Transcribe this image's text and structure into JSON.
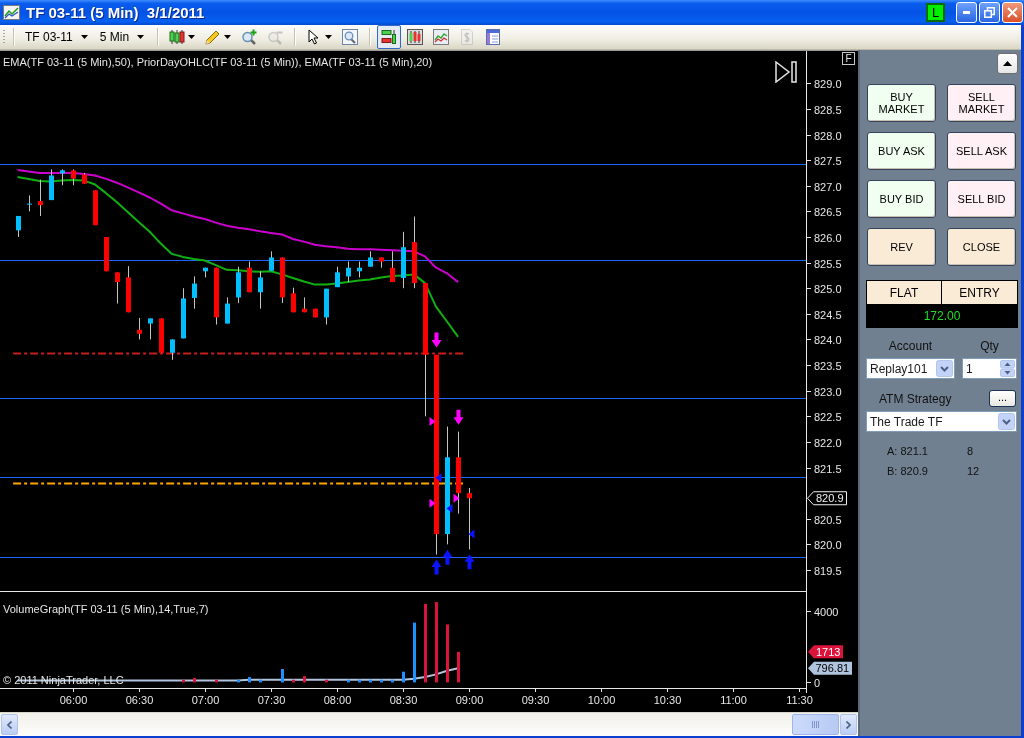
{
  "window": {
    "title": "TF 03-11 (5 Min)  3/1/2011",
    "connection_badge": "L"
  },
  "toolbar": {
    "instrument": "TF 03-11",
    "interval": "5 Min",
    "tool_groups": [
      [
        {
          "kind": "bar-style",
          "dropdown": true,
          "selected": false,
          "disabled": false
        },
        {
          "kind": "pencil",
          "dropdown": true,
          "selected": false,
          "disabled": false
        },
        {
          "kind": "zoom-in",
          "dropdown": false,
          "selected": false,
          "disabled": false
        },
        {
          "kind": "zoom-out",
          "dropdown": false,
          "selected": false,
          "disabled": true
        }
      ],
      [
        {
          "kind": "pointer",
          "dropdown": true,
          "selected": false,
          "disabled": false
        },
        {
          "kind": "zoom-box",
          "dropdown": false,
          "selected": false,
          "disabled": false
        }
      ],
      [
        {
          "kind": "chart-trader",
          "dropdown": false,
          "selected": true,
          "disabled": false
        },
        {
          "kind": "data-box",
          "dropdown": false,
          "selected": false,
          "disabled": false
        },
        {
          "kind": "indicators",
          "dropdown": false,
          "selected": false,
          "disabled": false
        },
        {
          "kind": "strategies",
          "dropdown": false,
          "selected": false,
          "disabled": true
        },
        {
          "kind": "properties",
          "dropdown": false,
          "selected": false,
          "disabled": false
        }
      ]
    ]
  },
  "chart": {
    "corner_button": "F",
    "price_pane": {
      "legend": "EMA(TF 03-11 (5 Min),50), PriorDayOHLC(TF 03-11 (5 Min)), EMA(TF 03-11 (5 Min),20)",
      "last_price": "820.9"
    },
    "volume_pane": {
      "legend": "VolumeGraph(TF 03-11 (5 Min),14,True,7)",
      "copyright": "© 2011 NinjaTrader, LLC",
      "last_volume": "1713",
      "average_volume": "796.81"
    },
    "chart_data": [
      {
        "type": "candlestick",
        "tick_labels": "y",
        "xlim": [
          "2011-03-01T05:27",
          "2011-03-01T11:33"
        ],
        "ylim": [
          819.07,
          829.63
        ],
        "yticks": [
          {
            "value": 819.5,
            "label": "819.5"
          },
          {
            "value": 820,
            "label": "820.0"
          },
          {
            "value": 820.5,
            "label": "820.5"
          },
          {
            "value": 821.5,
            "label": "821.5"
          },
          {
            "value": 822,
            "label": "822.0"
          },
          {
            "value": 822.5,
            "label": "822.5"
          },
          {
            "value": 823,
            "label": "823.0"
          },
          {
            "value": 823.5,
            "label": "823.5"
          },
          {
            "value": 824,
            "label": "824.0"
          },
          {
            "value": 824.5,
            "label": "824.5"
          },
          {
            "value": 825,
            "label": "825.0"
          },
          {
            "value": 825.5,
            "label": "825.5"
          },
          {
            "value": 826,
            "label": "826.0"
          },
          {
            "value": 826.5,
            "label": "826.5"
          },
          {
            "value": 827,
            "label": "827.0"
          },
          {
            "value": 827.5,
            "label": "827.5"
          },
          {
            "value": 828,
            "label": "828.0"
          },
          {
            "value": 828.5,
            "label": "828.5"
          },
          {
            "value": 829,
            "label": "829.0"
          }
        ],
        "x": [
          "2011-03-01T05:35",
          "2011-03-01T05:40",
          "2011-03-01T05:45",
          "2011-03-01T05:50",
          "2011-03-01T05:55",
          "2011-03-01T06:00",
          "2011-03-01T06:05",
          "2011-03-01T06:10",
          "2011-03-01T06:15",
          "2011-03-01T06:20",
          "2011-03-01T06:25",
          "2011-03-01T06:30",
          "2011-03-01T06:35",
          "2011-03-01T06:40",
          "2011-03-01T06:45",
          "2011-03-01T06:50",
          "2011-03-01T06:55",
          "2011-03-01T07:00",
          "2011-03-01T07:05",
          "2011-03-01T07:10",
          "2011-03-01T07:15",
          "2011-03-01T07:20",
          "2011-03-01T07:25",
          "2011-03-01T07:30",
          "2011-03-01T07:35",
          "2011-03-01T07:40",
          "2011-03-01T07:45",
          "2011-03-01T07:50",
          "2011-03-01T07:55",
          "2011-03-01T08:00",
          "2011-03-01T08:05",
          "2011-03-01T08:10",
          "2011-03-01T08:15",
          "2011-03-01T08:20",
          "2011-03-01T08:25",
          "2011-03-01T08:30",
          "2011-03-01T08:35",
          "2011-03-01T08:40",
          "2011-03-01T08:45",
          "2011-03-01T08:50",
          "2011-03-01T08:55",
          "2011-03-01T09:00"
        ],
        "ohlc": [
          [
            826.13,
            826.41,
            826.0,
            826.41
          ],
          [
            826.65,
            826.81,
            826.5,
            826.65
          ],
          [
            826.7,
            827.12,
            826.41,
            826.62
          ],
          [
            826.72,
            827.32,
            826.72,
            827.2
          ],
          [
            827.24,
            827.32,
            827.01,
            827.3
          ],
          [
            827.3,
            827.32,
            827.01,
            827.14
          ],
          [
            827.22,
            827.25,
            827.04,
            827.04
          ],
          [
            826.91,
            826.91,
            826.23,
            826.23
          ],
          [
            826.0,
            826.0,
            825.33,
            825.33
          ],
          [
            825.31,
            825.31,
            824.7,
            825.12
          ],
          [
            825.21,
            825.43,
            824.53,
            824.53
          ],
          [
            824.19,
            824.42,
            824.0,
            824.11
          ],
          [
            824.31,
            824.41,
            824.0,
            824.41
          ],
          [
            824.41,
            824.41,
            823.74,
            823.74
          ],
          [
            823.74,
            824.0,
            823.6,
            824.0
          ],
          [
            824.02,
            825.0,
            824.02,
            824.8
          ],
          [
            824.81,
            825.23,
            824.6,
            825.09
          ],
          [
            825.33,
            825.4,
            825.21,
            825.4
          ],
          [
            825.4,
            825.4,
            824.29,
            824.43
          ],
          [
            824.31,
            824.82,
            824.31,
            824.7
          ],
          [
            824.82,
            825.42,
            824.71,
            825.31
          ],
          [
            825.4,
            825.52,
            824.92,
            824.92
          ],
          [
            824.92,
            825.33,
            824.6,
            825.21
          ],
          [
            825.34,
            825.72,
            825.34,
            825.6
          ],
          [
            825.6,
            825.6,
            824.71,
            824.82
          ],
          [
            824.9,
            825.01,
            824.53,
            824.53
          ],
          [
            824.6,
            824.82,
            824.53,
            824.53
          ],
          [
            824.6,
            824.6,
            824.43,
            824.43
          ],
          [
            824.43,
            824.99,
            824.29,
            824.99
          ],
          [
            825.02,
            825.42,
            825.02,
            825.31
          ],
          [
            825.23,
            825.52,
            825.12,
            825.4
          ],
          [
            825.33,
            825.52,
            825.21,
            825.4
          ],
          [
            825.42,
            825.72,
            825.42,
            825.6
          ],
          [
            825.6,
            825.6,
            825.4,
            825.52
          ],
          [
            825.4,
            825.72,
            825.12,
            825.12
          ],
          [
            825.2,
            826.1,
            825.0,
            825.8
          ],
          [
            825.9,
            826.4,
            825.0,
            825.1
          ],
          [
            825.1,
            825.1,
            822.5,
            823.7
          ],
          [
            823.7,
            823.7,
            819.8,
            820.2
          ],
          [
            820.2,
            822.3,
            820.0,
            821.7
          ],
          [
            821.7,
            822.2,
            820.6,
            821.0
          ],
          [
            821.0,
            821.1,
            819.9,
            820.9
          ]
        ],
        "colors": [
          "#00bfff",
          "#00bfff",
          "#ff0000",
          "#00bfff",
          "#00bfff",
          "#ff0000",
          "#ff0000",
          "#ff0000",
          "#ff0000",
          "#ff0000",
          "#ff0000",
          "#ff0000",
          "#00bfff",
          "#ff0000",
          "#00bfff",
          "#00bfff",
          "#00bfff",
          "#00bfff",
          "#ff0000",
          "#00bfff",
          "#00bfff",
          "#ff0000",
          "#00bfff",
          "#00bfff",
          "#ff0000",
          "#ff0000",
          "#ff0000",
          "#ff0000",
          "#00bfff",
          "#00bfff",
          "#00bfff",
          "#00bfff",
          "#00bfff",
          "#ff0000",
          "#ff0000",
          "#00bfff",
          "#ff0000",
          "#ff0000",
          "#ff0000",
          "#00bfff",
          "#ff0000",
          "#ff0000"
        ],
        "series": [
          {
            "type": "line",
            "color": "#cc00cc",
            "values": [
              827.31,
              827.28,
              827.25,
              827.25,
              827.25,
              827.25,
              827.23,
              827.2,
              827.14,
              827.06,
              826.97,
              826.87,
              826.77,
              826.65,
              826.52,
              826.46,
              826.4,
              826.35,
              826.28,
              826.22,
              826.18,
              826.15,
              826.11,
              826.08,
              826.05,
              825.96,
              825.91,
              825.85,
              825.82,
              825.8,
              825.77,
              825.76,
              825.76,
              825.75,
              825.74,
              825.73,
              825.72,
              825.62,
              825.4,
              825.29,
              825.12,
              null
            ]
          },
          {
            "type": "line",
            "color": "#10b010",
            "values": [
              827.17,
              827.13,
              827.09,
              827.08,
              827.1,
              827.11,
              827.1,
              827.03,
              826.86,
              826.68,
              826.49,
              826.29,
              826.1,
              825.87,
              825.67,
              825.61,
              825.57,
              825.54,
              825.45,
              825.36,
              825.35,
              825.33,
              825.32,
              825.33,
              825.27,
              825.2,
              825.13,
              825.07,
              825.07,
              825.09,
              825.12,
              825.15,
              825.17,
              825.21,
              825.24,
              825.25,
              825.27,
              825.1,
              824.64,
              824.35,
              824.05,
              null
            ]
          },
          {
            "type": "scatter",
            "color": "#ff00ff",
            "x": [
              "2011-03-01T08:45",
              "2011-03-01T08:55"
            ],
            "values": [
              823.99,
              822.48
            ]
          },
          {
            "type": "scatter",
            "color": "#0a14ff",
            "x": [
              "2011-03-01T08:45",
              "2011-03-01T08:50",
              "2011-03-01T09:00"
            ],
            "values": [
              819.56,
              819.75,
              819.66
            ]
          },
          {
            "type": "scatter",
            "marker": "triangle",
            "color": "#ff00ff",
            "x": [
              "2011-03-01T08:43",
              "2011-03-01T08:43",
              "2011-03-01T08:54"
            ],
            "values": [
              822.4,
              820.8,
              820.9
            ]
          },
          {
            "type": "scatter",
            "marker": "triangle",
            "color": "#0a14ff",
            "x": [
              "2011-03-01T08:46",
              "2011-03-01T08:51",
              "2011-03-01T09:01"
            ],
            "values": [
              821.3,
              820.7,
              820.2
            ]
          }
        ],
        "ref_lines": [
          {
            "axis": "y",
            "value": 827.42,
            "color": "#1e64ff",
            "line_style": "solid"
          },
          {
            "axis": "y",
            "value": 825.56,
            "color": "#1e64ff",
            "line_style": "solid"
          },
          {
            "axis": "y",
            "value": 823.74,
            "color": "#c81e1e",
            "line_style": "dashdot"
          },
          {
            "axis": "y",
            "value": 822.86,
            "color": "#1e64ff",
            "line_style": "solid"
          },
          {
            "axis": "y",
            "value": 821.32,
            "color": "#1e64ff",
            "line_style": "solid"
          },
          {
            "axis": "y",
            "value": 821.2,
            "color": "#ffa500",
            "line_style": "dashdot"
          },
          {
            "axis": "y",
            "value": 819.76,
            "color": "#1e64ff",
            "line_style": "solid"
          }
        ]
      },
      {
        "type": "bar",
        "xlim": [
          "2011-03-01T05:27",
          "2011-03-01T11:33"
        ],
        "ylim": [
          -314,
          5064
        ],
        "yticks": [
          {
            "value": 0,
            "label": "0"
          },
          {
            "value": 4000,
            "label": "4000"
          }
        ],
        "xticks": [
          {
            "value": "2011-03-01T06:00",
            "label": "06:00"
          },
          {
            "value": "2011-03-01T06:30",
            "label": "06:30"
          },
          {
            "value": "2011-03-01T07:00",
            "label": "07:00"
          },
          {
            "value": "2011-03-01T07:30",
            "label": "07:30"
          },
          {
            "value": "2011-03-01T08:00",
            "label": "08:00"
          },
          {
            "value": "2011-03-01T08:30",
            "label": "08:30"
          },
          {
            "value": "2011-03-01T09:00",
            "label": "09:00"
          },
          {
            "value": "2011-03-01T09:30",
            "label": "09:30"
          },
          {
            "value": "2011-03-01T10:00",
            "label": "10:00"
          },
          {
            "value": "2011-03-01T10:30",
            "label": "10:30"
          },
          {
            "value": "2011-03-01T11:00",
            "label": "11:00"
          },
          {
            "value": "2011-03-01T11:30",
            "label": "11:30"
          }
        ],
        "x": [
          "2011-03-01T05:35",
          "2011-03-01T05:40",
          "2011-03-01T05:45",
          "2011-03-01T05:50",
          "2011-03-01T05:55",
          "2011-03-01T06:00",
          "2011-03-01T06:05",
          "2011-03-01T06:10",
          "2011-03-01T06:15",
          "2011-03-01T06:20",
          "2011-03-01T06:25",
          "2011-03-01T06:30",
          "2011-03-01T06:35",
          "2011-03-01T06:40",
          "2011-03-01T06:45",
          "2011-03-01T06:50",
          "2011-03-01T06:55",
          "2011-03-01T07:00",
          "2011-03-01T07:05",
          "2011-03-01T07:10",
          "2011-03-01T07:15",
          "2011-03-01T07:20",
          "2011-03-01T07:25",
          "2011-03-01T07:30",
          "2011-03-01T07:35",
          "2011-03-01T07:40",
          "2011-03-01T07:45",
          "2011-03-01T07:50",
          "2011-03-01T07:55",
          "2011-03-01T08:00",
          "2011-03-01T08:05",
          "2011-03-01T08:10",
          "2011-03-01T08:15",
          "2011-03-01T08:20",
          "2011-03-01T08:25",
          "2011-03-01T08:30",
          "2011-03-01T08:35",
          "2011-03-01T08:40",
          "2011-03-01T08:45",
          "2011-03-01T08:50",
          "2011-03-01T08:55"
        ],
        "values": [
          null,
          null,
          null,
          null,
          null,
          null,
          null,
          null,
          null,
          null,
          null,
          null,
          null,
          null,
          null,
          150,
          250,
          null,
          150,
          null,
          150,
          300,
          150,
          null,
          750,
          150,
          350,
          null,
          150,
          null,
          150,
          150,
          150,
          150,
          150,
          600,
          3350,
          4400,
          4500,
          3250,
          1713
        ],
        "colors": [
          null,
          null,
          null,
          null,
          null,
          null,
          null,
          null,
          null,
          null,
          null,
          null,
          null,
          null,
          null,
          "#dc143c",
          "#dc143c",
          null,
          "#dc143c",
          null,
          "#1e90ff",
          "#1e90ff",
          "#1e90ff",
          null,
          "#1e90ff",
          "#dc143c",
          "#dc143c",
          null,
          "#dc143c",
          null,
          "#1e90ff",
          "#1e90ff",
          "#1e90ff",
          "#1e90ff",
          "#1e90ff",
          "#1e90ff",
          "#1e90ff",
          "#dc143c",
          "#dc143c",
          "#dc143c",
          "#dc143c"
        ],
        "series": [
          {
            "type": "line",
            "color": "#b0c4de",
            "values": [
              100,
              100,
              100,
              100,
              100,
              100,
              100,
              100,
              100,
              100,
              100,
              100,
              100,
              100,
              100,
              100,
              100,
              100,
              100,
              100,
              100,
              150,
              150,
              150,
              150,
              150,
              150,
              150,
              150,
              150,
              150,
              150,
              150,
              150,
              150,
              150,
              200,
              300,
              450,
              650,
              796.81
            ]
          }
        ]
      }
    ]
  },
  "trader": {
    "buttons": [
      {
        "label": "BUY MARKET",
        "kind": "buy"
      },
      {
        "label": "SELL MARKET",
        "kind": "sell"
      },
      {
        "label": "BUY ASK",
        "kind": "buy"
      },
      {
        "label": "SELL ASK",
        "kind": "sell"
      },
      {
        "label": "BUY BID",
        "kind": "buy"
      },
      {
        "label": "SELL BID",
        "kind": "sell"
      },
      {
        "label": "REV",
        "kind": "neutral"
      },
      {
        "label": "CLOSE",
        "kind": "neutral"
      }
    ],
    "position": {
      "status": "FLAT",
      "entry_label": "ENTRY",
      "value": "172.00"
    },
    "account": {
      "label": "Account",
      "value": "Replay101"
    },
    "quantity": {
      "label": "Qty",
      "value": "1"
    },
    "atm_strategy": {
      "label": "ATM Strategy",
      "button": "...",
      "value": "The Trade TF"
    },
    "quotes": [
      {
        "label": "A: 821.1",
        "size": "8"
      },
      {
        "label": "B: 820.9",
        "size": "12"
      }
    ]
  }
}
